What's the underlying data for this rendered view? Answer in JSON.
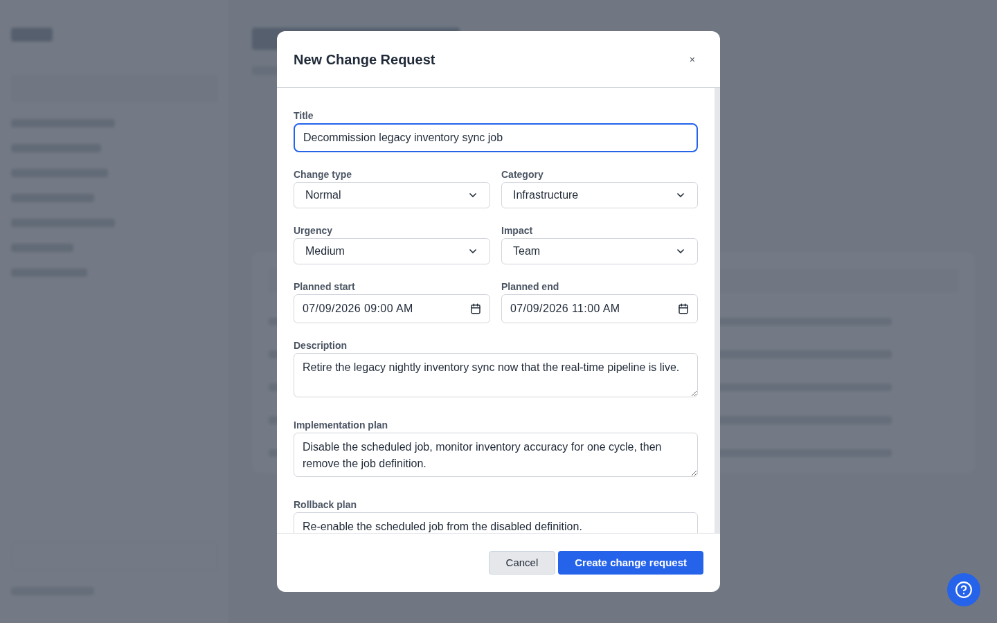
{
  "dialog": {
    "title": "New Change Request",
    "close": "×",
    "fields": [
      {
        "kind": "text",
        "label": "Title",
        "value": "Decommission legacy inventory sync job",
        "focused": true
      },
      {
        "kind": "select",
        "label": "Change type",
        "value": "Normal"
      },
      {
        "kind": "select",
        "label": "Category",
        "value": "Infrastructure"
      },
      {
        "kind": "select",
        "label": "Urgency",
        "value": "Medium"
      },
      {
        "kind": "select",
        "label": "Impact",
        "value": "Team"
      },
      {
        "kind": "datetime",
        "label": "Planned start",
        "value": "07/09/2026 09:00 AM"
      },
      {
        "kind": "datetime",
        "label": "Planned end",
        "value": "07/09/2026 11:00 AM"
      },
      {
        "kind": "textarea",
        "label": "Description",
        "value": "Retire the legacy nightly inventory sync now that the real-time pipeline is live."
      },
      {
        "kind": "textarea",
        "label": "Implementation plan",
        "value": "Disable the scheduled job, monitor inventory accuracy for one cycle, then remove the job definition."
      },
      {
        "kind": "textarea",
        "label": "Rollback plan",
        "value": "Re-enable the scheduled job from the disabled definition."
      }
    ],
    "buttons": [
      {
        "label": "Cancel",
        "kind": "secondary"
      },
      {
        "label": "Create change request",
        "kind": "primary"
      }
    ]
  }
}
